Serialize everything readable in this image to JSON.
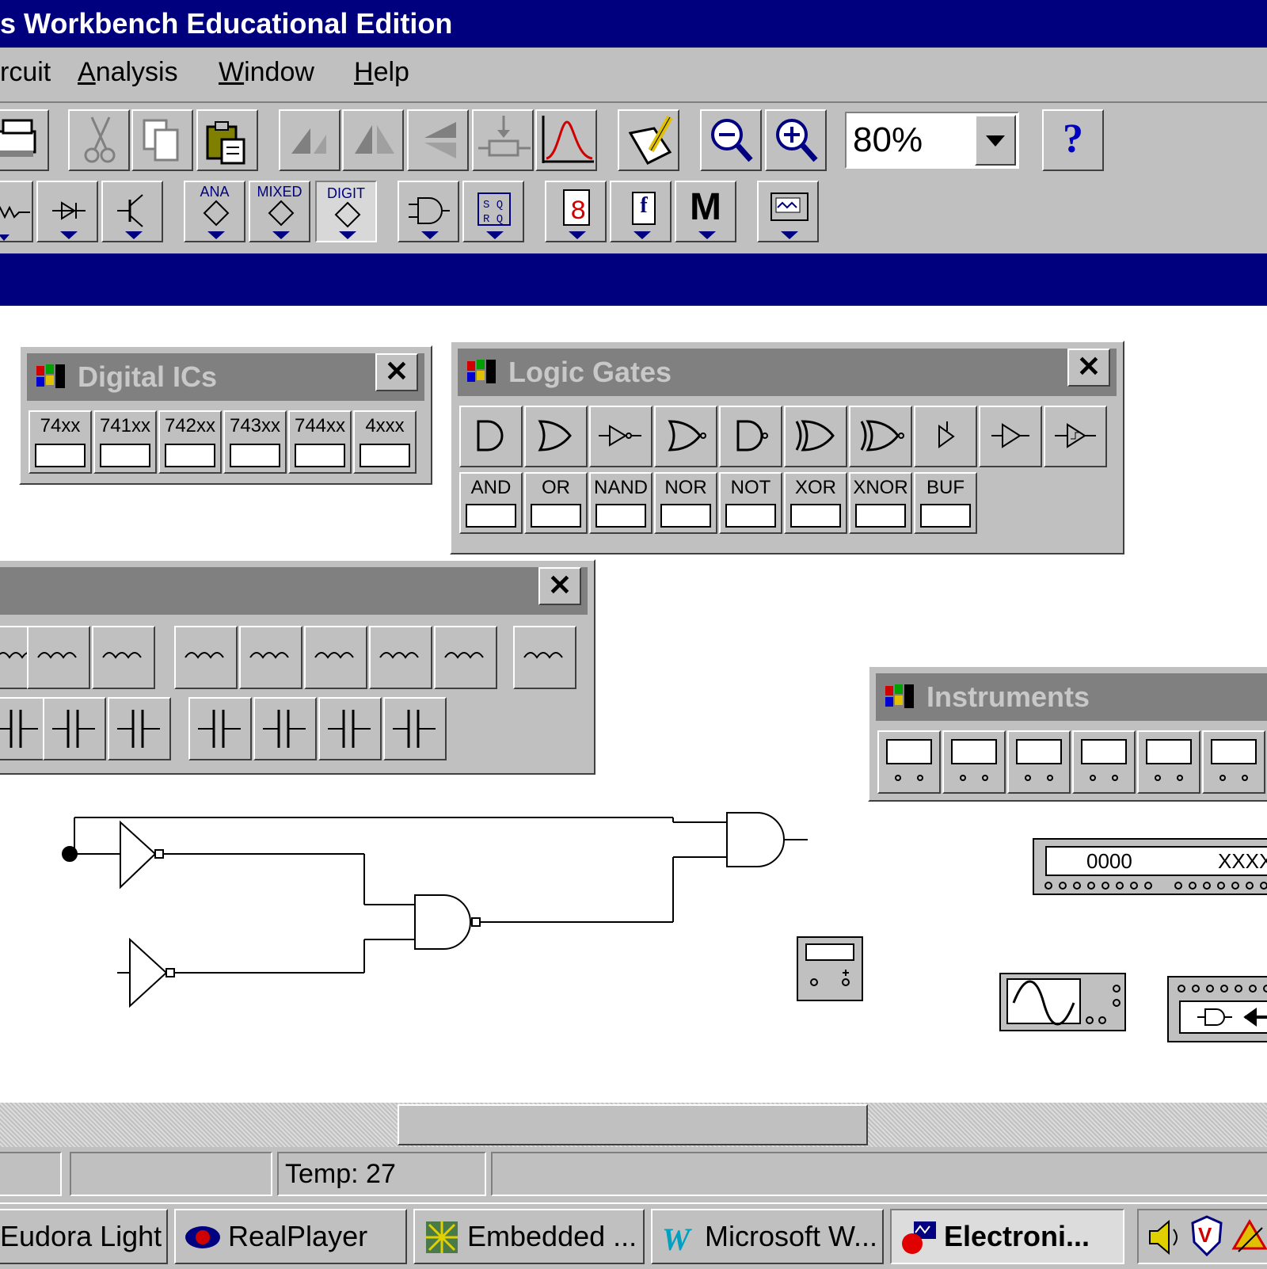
{
  "window": {
    "title": "s Workbench Educational Edition"
  },
  "menu": {
    "items": [
      "rcuit",
      "Analysis",
      "Window",
      "Help"
    ],
    "underline_index": [
      null,
      0,
      0,
      0
    ]
  },
  "toolbar": {
    "zoom_value": "80%",
    "help_label": "?",
    "parts_bin": {
      "ana_label": "ANA",
      "mixed_label": "MIXED",
      "digit_label": "DIGIT",
      "misc_label": "M",
      "func_label": "f"
    }
  },
  "palettes": {
    "digital_ics": {
      "title": "Digital ICs",
      "close": "✕",
      "items": [
        "74xx",
        "741xx",
        "742xx",
        "743xx",
        "744xx",
        "4xxx"
      ]
    },
    "logic_gates": {
      "title": "Logic Gates",
      "close": "✕",
      "items": [
        "AND",
        "OR",
        "NAND",
        "NOR",
        "NOT",
        "XOR",
        "XNOR",
        "BUF"
      ]
    },
    "basic": {
      "title": "",
      "close": "✕"
    },
    "instruments": {
      "title": "Instruments"
    }
  },
  "canvas": {
    "word_generator_left": "0000",
    "word_generator_right": "XXXX"
  },
  "status": {
    "temp": "Temp:  27"
  },
  "taskbar": {
    "tasks": [
      "Eudora Light",
      "RealPlayer",
      "Embedded ...",
      "Microsoft W...",
      "Electroni..."
    ]
  },
  "colors": {
    "title_blue": "#00007e",
    "face": "#c0c0c0"
  }
}
